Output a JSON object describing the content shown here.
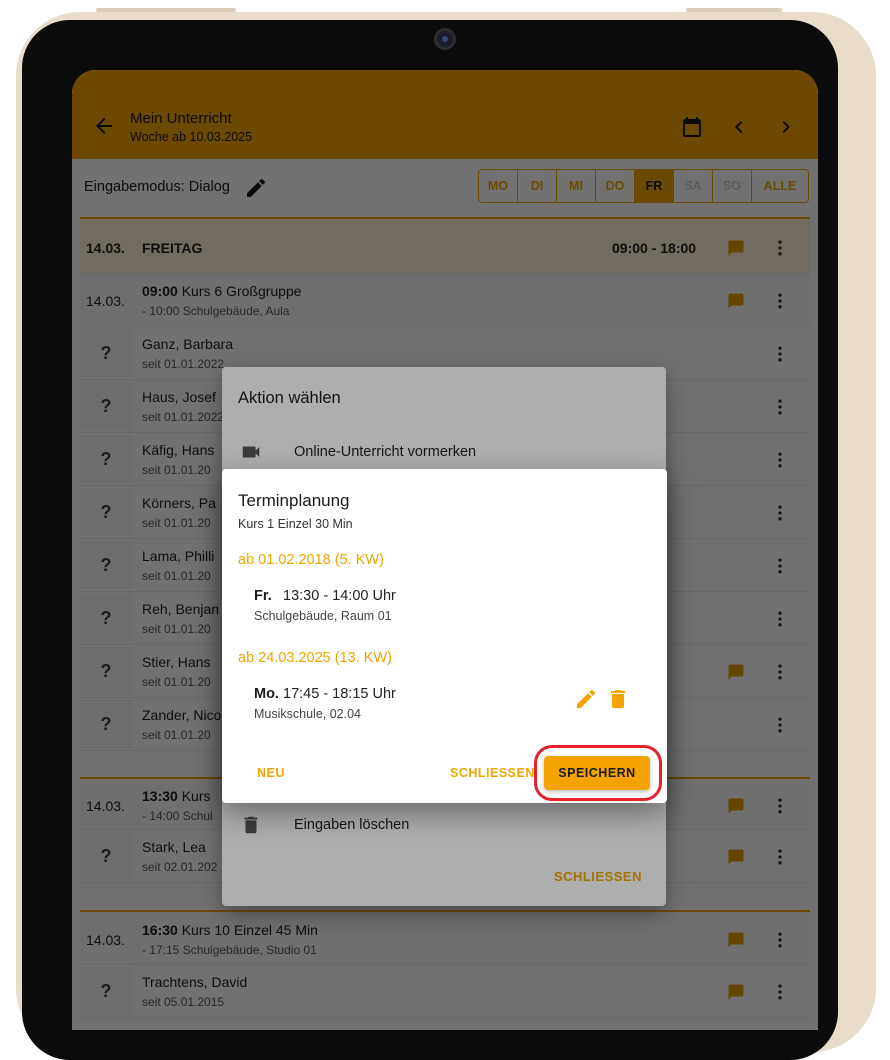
{
  "appbar": {
    "title": "Mein Unterricht",
    "subtitle": "Woche ab 10.03.2025",
    "icons": [
      "back-arrow-icon",
      "calendar-icon",
      "chevron-left-icon",
      "chevron-right-icon"
    ]
  },
  "modebar": {
    "label": "Eingabemodus: Dialog",
    "days": [
      "MO",
      "DI",
      "MI",
      "DO",
      "FR",
      "SA",
      "SO",
      "ALLE"
    ],
    "selected_day": "FR"
  },
  "list": {
    "day_header": {
      "date": "14.03.",
      "weekday": "FREITAG",
      "range": "09:00 - 18:00"
    },
    "course1": {
      "date": "14.03.",
      "time": "09:00",
      "name": " Kurs 6 Großgruppe",
      "detail": "- 10:00 Schulgebäude, Aula"
    },
    "students1": [
      {
        "q": "?",
        "name": "Ganz, Barbara",
        "since": "seit 01.01.2022"
      },
      {
        "q": "?",
        "name": "Haus, Josef",
        "since": "seit 01.01.2022"
      },
      {
        "q": "?",
        "name": "Käfig, Hans",
        "since": "seit 01.01.20"
      },
      {
        "q": "?",
        "name": "Körners, Pa",
        "since": "seit 01.01.20"
      },
      {
        "q": "?",
        "name": "Lama, Philli",
        "since": "seit 01.01.20"
      },
      {
        "q": "?",
        "name": "Reh, Benjan",
        "since": "seit 01.01.20"
      },
      {
        "q": "?",
        "name": "Stier, Hans",
        "since": "seit 01.01.20"
      },
      {
        "q": "?",
        "name": "Zander, Nico",
        "since": "seit 01.01.20"
      }
    ],
    "course2": {
      "date": "14.03.",
      "time": "13:30",
      "name": " Kurs",
      "detail": "- 14:00 Schul"
    },
    "student2": {
      "q": "?",
      "name": "Stark, Lea",
      "since": "seit 02.01.202"
    },
    "course3": {
      "date": "14.03.",
      "time": "16:30",
      "name": " Kurs 10 Einzel 45 Min",
      "detail": "- 17:15 Schulgebäude, Studio 01"
    },
    "student3": {
      "q": "?",
      "name": "Trachtens, David",
      "since": "seit 05.01.2015"
    }
  },
  "dialog_action": {
    "title": "Aktion wählen",
    "item_online": "Online-Unterricht vormerken",
    "item_delete": "Eingaben löschen",
    "close": "SCHLIESSEN"
  },
  "dialog_plan": {
    "title": "Terminplanung",
    "subtitle": "Kurs 1 Einzel 30 Min",
    "section1": "ab 01.02.2018 (5. KW)",
    "entry1": {
      "weekday": "Fr.",
      "time": "13:30 - 14:00 Uhr",
      "location": "Schulgebäude, Raum 01"
    },
    "section2": "ab 24.03.2025 (13. KW)",
    "entry2": {
      "weekday": "Mo.",
      "time": "17:45 - 18:15 Uhr",
      "location": "Musikschule, 02.04"
    },
    "btn_new": "NEU",
    "btn_close": "SCHLIESSEN",
    "btn_save": "SPEICHERN"
  },
  "colors": {
    "accent": "#f5a300",
    "highlight": "#e6212a"
  }
}
